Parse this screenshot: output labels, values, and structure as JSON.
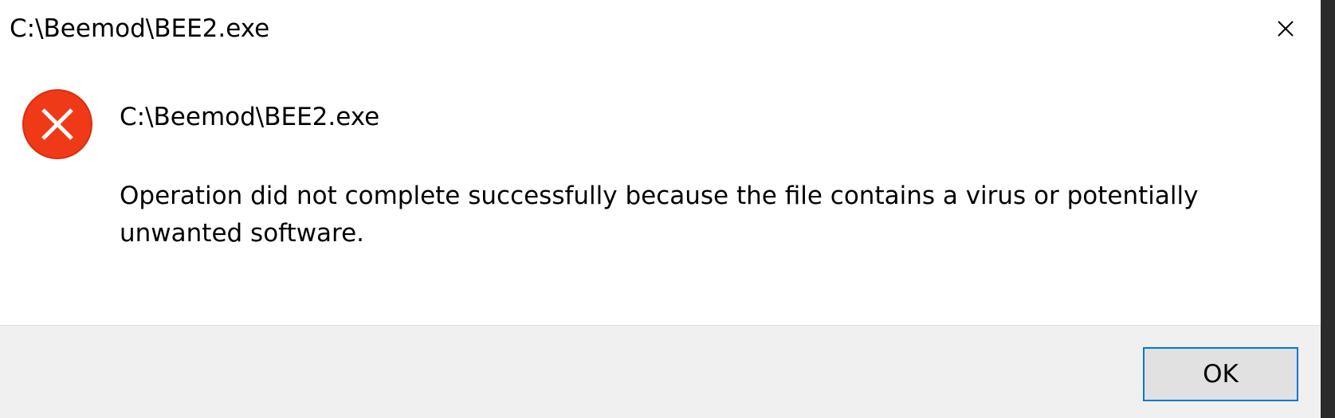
{
  "window": {
    "title": "C:\\Beemod\\BEE2.exe",
    "close_icon": "close-icon"
  },
  "content": {
    "icon": "error-icon",
    "icon_color": "#f03a17",
    "heading": "C:\\Beemod\\BEE2.exe",
    "message": "Operation did not complete successfully because the file contains a virus or potentially unwanted software."
  },
  "footer": {
    "ok_label": "OK",
    "ok_border_color": "#0078d7"
  }
}
